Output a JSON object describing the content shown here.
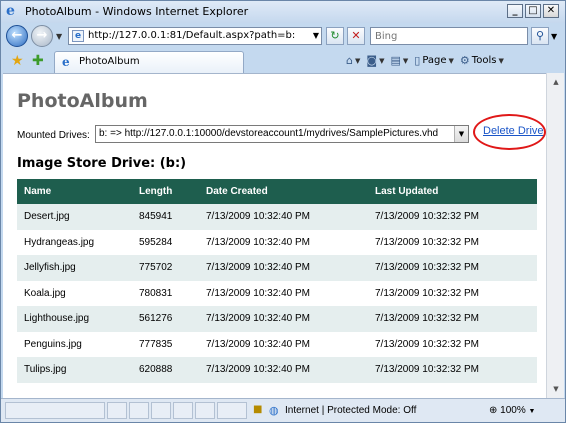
{
  "window": {
    "title": "PhotoAlbum - Windows Internet Explorer"
  },
  "address_bar": {
    "url": "http://127.0.0.1:81/Default.aspx?path=b:"
  },
  "search": {
    "placeholder": "Bing"
  },
  "tab": {
    "title": "PhotoAlbum"
  },
  "commands": {
    "page_label": "Page",
    "tools_label": "Tools"
  },
  "page": {
    "title": "PhotoAlbum",
    "mounted_label": "Mounted Drives:",
    "mounted_value": "b: => http://127.0.0.1:10000/devstoreaccount1/mydrives/SamplePictures.vhd",
    "delete_link": "Delete Drive",
    "store_heading": "Image Store Drive: (b:)"
  },
  "table": {
    "headers": [
      "Name",
      "Length",
      "Date Created",
      "Last Updated"
    ],
    "rows": [
      [
        "Desert.jpg",
        "845941",
        "7/13/2009 10:32:40 PM",
        "7/13/2009 10:32:32 PM"
      ],
      [
        "Hydrangeas.jpg",
        "595284",
        "7/13/2009 10:32:40 PM",
        "7/13/2009 10:32:32 PM"
      ],
      [
        "Jellyfish.jpg",
        "775702",
        "7/13/2009 10:32:40 PM",
        "7/13/2009 10:32:32 PM"
      ],
      [
        "Koala.jpg",
        "780831",
        "7/13/2009 10:32:40 PM",
        "7/13/2009 10:32:32 PM"
      ],
      [
        "Lighthouse.jpg",
        "561276",
        "7/13/2009 10:32:40 PM",
        "7/13/2009 10:32:32 PM"
      ],
      [
        "Penguins.jpg",
        "777835",
        "7/13/2009 10:32:40 PM",
        "7/13/2009 10:32:32 PM"
      ],
      [
        "Tulips.jpg",
        "620888",
        "7/13/2009 10:32:40 PM",
        "7/13/2009 10:32:32 PM"
      ]
    ]
  },
  "statusbar": {
    "zone": "Internet | Protected Mode: Off",
    "zoom": "100%"
  },
  "icons": {
    "back": "back-arrow-icon",
    "forward": "forward-arrow-icon",
    "refresh": "refresh-icon",
    "stop": "stop-icon",
    "search": "search-icon",
    "favorites": "favorites-star-icon",
    "add_favorite": "add-favorite-icon",
    "home": "home-icon",
    "feeds": "feeds-icon",
    "print": "print-icon",
    "tools": "gear-icon",
    "zone": "globe-icon",
    "lock": "lock-icon",
    "zoom": "zoom-icon"
  },
  "colors": {
    "table_header": "#1e5e4e",
    "row_alt": "#e5eeee",
    "link": "#1a55c8",
    "highlight_circle": "#e01818",
    "page_title": "#666666"
  }
}
